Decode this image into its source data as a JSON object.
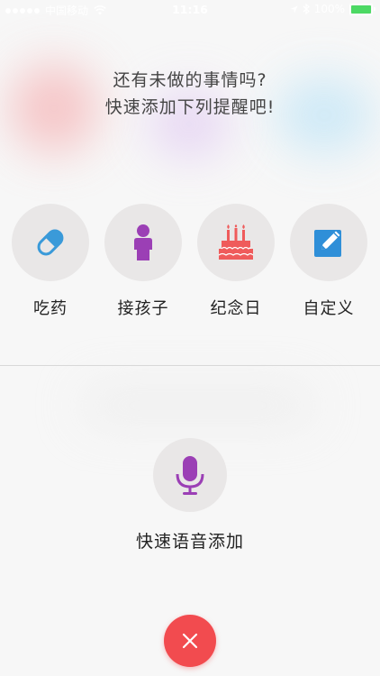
{
  "status_bar": {
    "carrier": "中国移动",
    "time": "11:16",
    "battery_percent": "100%",
    "battery_level": 1.0,
    "battery_color": "#4cd964"
  },
  "headline": {
    "line1": "还有未做的事情吗?",
    "line2": "快速添加下列提醒吧!"
  },
  "quick_reminders": [
    {
      "label": "吃药",
      "icon": "pill-icon",
      "color": "#3a9ad9"
    },
    {
      "label": "接孩子",
      "icon": "child-icon",
      "color": "#9b3fb5"
    },
    {
      "label": "纪念日",
      "icon": "cake-icon",
      "color": "#ef5b5b"
    },
    {
      "label": "自定义",
      "icon": "edit-icon",
      "color": "#2f8fd8"
    }
  ],
  "voice": {
    "label": "快速语音添加",
    "icon": "microphone-icon",
    "color": "#9b3fb5"
  },
  "close": {
    "icon": "close-icon",
    "color": "#f24b4f"
  }
}
